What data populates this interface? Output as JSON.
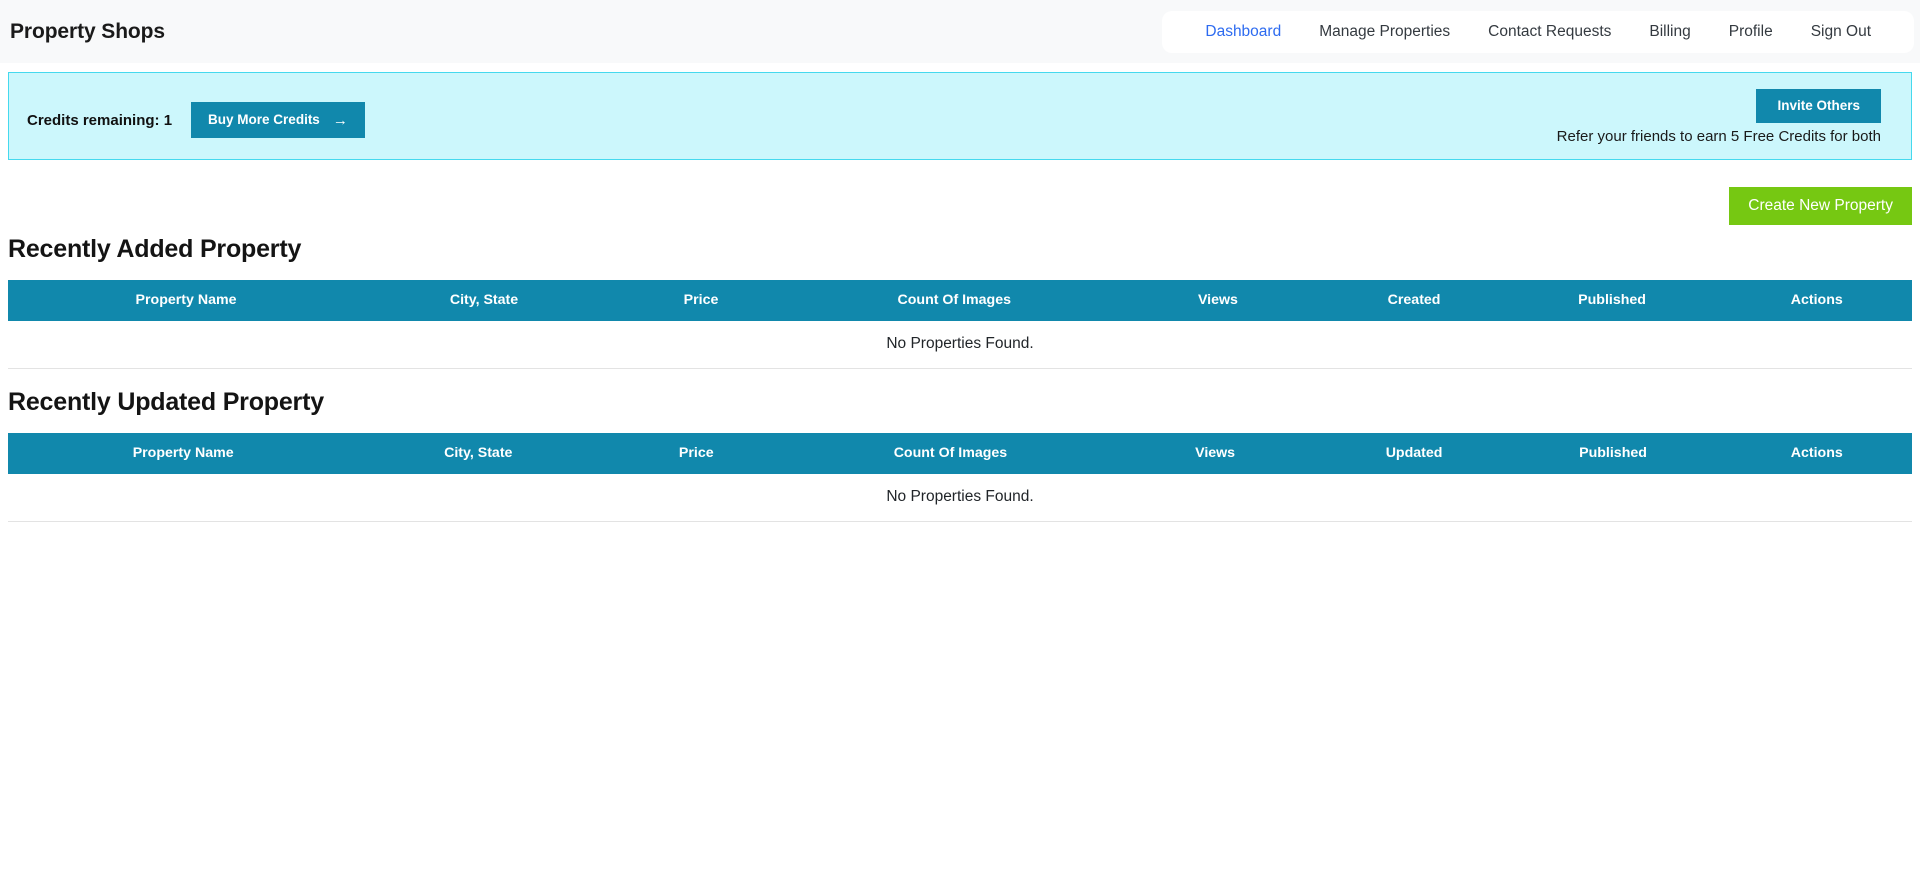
{
  "header": {
    "brand": "Property Shops",
    "nav": [
      {
        "label": "Dashboard",
        "active": true
      },
      {
        "label": "Manage Properties",
        "active": false
      },
      {
        "label": "Contact Requests",
        "active": false
      },
      {
        "label": "Billing",
        "active": false
      },
      {
        "label": "Profile",
        "active": false
      },
      {
        "label": "Sign Out",
        "active": false
      }
    ]
  },
  "credits_banner": {
    "credits_text": "Credits remaining: 1",
    "buy_button_label": "Buy More Credits",
    "buy_button_icon": "arrow-right-icon",
    "invite_button_label": "Invite Others",
    "refer_text": "Refer your friends to earn 5 Free Credits for both",
    "background_color": "#ccf7fc",
    "border_color": "#45d9ee",
    "button_color": "#1188ac"
  },
  "actions": {
    "create_new_property_label": "Create New Property",
    "create_button_color": "#76c812"
  },
  "sections": [
    {
      "title": "Recently Added Property",
      "columns": [
        "Property Name",
        "City, State",
        "Price",
        "Count Of Images",
        "Views",
        "Created",
        "Published",
        "Actions"
      ],
      "rows": [],
      "empty_message": "No Properties Found.",
      "header_color": "#1188ac"
    },
    {
      "title": "Recently Updated Property",
      "columns": [
        "Property Name",
        "City, State",
        "Price",
        "Count Of Images",
        "Views",
        "Updated",
        "Published",
        "Actions"
      ],
      "rows": [],
      "empty_message": "No Properties Found.",
      "header_color": "#1188ac"
    }
  ]
}
